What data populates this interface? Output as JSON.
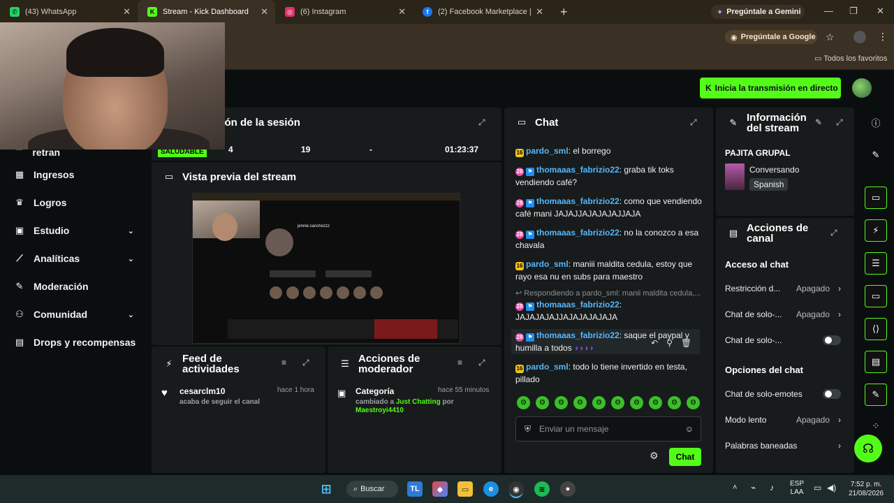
{
  "browser": {
    "tabs": [
      {
        "title": "(43) WhatsApp",
        "icon": "whatsapp-icon",
        "color": "#25d366"
      },
      {
        "title": "Stream - Kick Dashboard",
        "icon": "kick-icon",
        "color": "#53fc18"
      },
      {
        "title": "(6) Instagram",
        "icon": "instagram-icon",
        "color": "#e1306c"
      },
      {
        "title": "(2) Facebook Marketplace | Fac",
        "icon": "facebook-icon",
        "color": "#1877f2"
      }
    ],
    "gemini_label": "Pregúntale a Gemini",
    "ask_google": "Pregúntale a Google",
    "all_favorites": "Todos los favoritos"
  },
  "header": {
    "go_live": "Inicia la transmisión en directo"
  },
  "sidebar": {
    "cut_label": "Servidor y clave de retran",
    "items": [
      {
        "label": "Ingresos",
        "icon": "ingresos-icon",
        "has_chevron": false
      },
      {
        "label": "Logros",
        "icon": "trophy-icon",
        "has_chevron": false
      },
      {
        "label": "Estudio",
        "icon": "studio-icon",
        "has_chevron": true
      },
      {
        "label": "Analíticas",
        "icon": "analytics-icon",
        "has_chevron": true
      },
      {
        "label": "Moderación",
        "icon": "wrench-icon",
        "has_chevron": false
      },
      {
        "label": "Comunidad",
        "icon": "community-icon",
        "has_chevron": true
      },
      {
        "label": "Drops y recompensas",
        "icon": "gift-icon",
        "has_chevron": false
      }
    ]
  },
  "session": {
    "title": "ción de la sesión",
    "status": "SALUDABLE",
    "stats": [
      "4",
      "19",
      "-",
      "01:23:37"
    ]
  },
  "preview": {
    "title": "Vista previa del stream",
    "profile_name": "jennie.sanchezzz"
  },
  "feed": {
    "title_line1": "Feed de",
    "title_line2": "actividades",
    "user": "cesarclm10",
    "time": "hace 1 hora",
    "action": "acaba de seguir el canal"
  },
  "modactions": {
    "title_line1": "Acciones de",
    "title_line2": "moderador",
    "item_title": "Categoría",
    "time": "hace 55 minutos",
    "changed_prefix": "cambiado a",
    "category": "Just Chatting",
    "by": "por",
    "moderator": "Maestroyi4410"
  },
  "chat": {
    "title": "Chat",
    "messages": [
      {
        "badge": "16",
        "user": "pardo_sml",
        "text": "el borrego"
      },
      {
        "badge": "28",
        "user": "thomaaas_fabrizio22",
        "text": "graba tik toks vendiendo café?"
      },
      {
        "badge": "28",
        "user": "thomaaas_fabrizio22",
        "text": "como que vendiendo café mani JAJAJJAJAJAJAJJAJA"
      },
      {
        "badge": "28",
        "user": "thomaaas_fabrizio22",
        "text": "no la conozco a esa chavala"
      },
      {
        "badge": "16",
        "user": "pardo_sml",
        "text": "maniii maldita cedula, estoy que rayo esa nu en subs para maestro"
      },
      {
        "badge": "28",
        "user": "thomaaas_fabrizio22",
        "text": "JAJAJAJAJJAJAJAJAJAJA"
      },
      {
        "badge": "28",
        "user": "thomaaas_fabrizio22",
        "text": "saque el paypal y humilla a todos"
      },
      {
        "badge": "16",
        "user": "pardo_sml",
        "text": "todo lo tiene invertido en testa, pillado"
      }
    ],
    "reply_hint": "Respondiendo a pardo_sml: manii maldita cedula,...",
    "input_placeholder": "Enviar un mensaje",
    "send_label": "Chat"
  },
  "stream_info": {
    "title_line1": "Información",
    "title_line2": "del stream",
    "stream_title": "PAJITA GRUPAL",
    "category": "Conversando",
    "language": "Spanish"
  },
  "channel_actions": {
    "title_line1": "Acciones de",
    "title_line2": "canal",
    "access_title": "Acceso al chat",
    "rows": [
      {
        "label": "Restricción d...",
        "value": "Apagado"
      },
      {
        "label": "Chat de solo-...",
        "value": "Apagado"
      },
      {
        "label": "Chat de solo-...",
        "value": ""
      }
    ],
    "options_title": "Opciones del chat",
    "option_rows": [
      {
        "label": "Chat de solo-emotes",
        "value": ""
      },
      {
        "label": "Modo lento",
        "value": "Apagado"
      },
      {
        "label": "Palabras baneadas",
        "value": ""
      }
    ]
  },
  "taskbar": {
    "search": "Buscar",
    "lang1": "ESP",
    "lang2": "LAA",
    "time": "7:52 p. m.",
    "date": "21/08/2026"
  },
  "colors": {
    "accent": "#53fc18",
    "panel": "#181b1c",
    "bg": "#0b0e0f",
    "username": "#53b7fc"
  }
}
